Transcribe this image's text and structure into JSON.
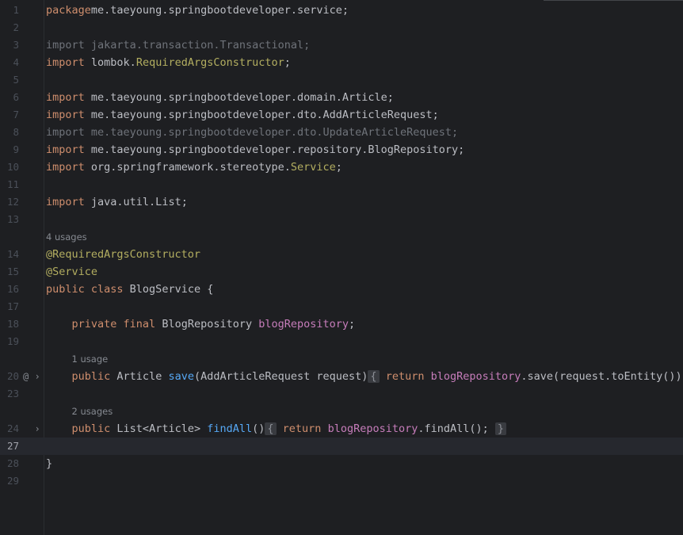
{
  "editor": {
    "lines": [
      {
        "ln": "1",
        "tokens": [
          [
            "kw",
            "package"
          ],
          [
            "",
            "me.taeyoung.springbootdeveloper.service;"
          ]
        ]
      },
      {
        "ln": "2",
        "tokens": []
      },
      {
        "ln": "3",
        "tokens": [
          [
            "dim",
            "import jakarta.transaction.Transactional;"
          ]
        ]
      },
      {
        "ln": "4",
        "tokens": [
          [
            "kw",
            "import"
          ],
          [
            "",
            " lombok."
          ],
          [
            "ann",
            "RequiredArgsConstructor"
          ],
          [
            "",
            ";"
          ]
        ]
      },
      {
        "ln": "5",
        "tokens": []
      },
      {
        "ln": "6",
        "tokens": [
          [
            "kw",
            "import"
          ],
          [
            "",
            " me.taeyoung.springbootdeveloper.domain.Article;"
          ]
        ]
      },
      {
        "ln": "7",
        "tokens": [
          [
            "kw",
            "import"
          ],
          [
            "",
            " me.taeyoung.springbootdeveloper.dto.AddArticleRequest;"
          ]
        ]
      },
      {
        "ln": "8",
        "tokens": [
          [
            "dim",
            "import me.taeyoung.springbootdeveloper.dto.UpdateArticleRequest;"
          ]
        ]
      },
      {
        "ln": "9",
        "tokens": [
          [
            "kw",
            "import"
          ],
          [
            "",
            " me.taeyoung.springbootdeveloper.repository.BlogRepository;"
          ]
        ]
      },
      {
        "ln": "10",
        "tokens": [
          [
            "kw",
            "import"
          ],
          [
            "",
            " org.springframework.stereotype."
          ],
          [
            "ann",
            "Service"
          ],
          [
            "",
            ";"
          ]
        ]
      },
      {
        "ln": "11",
        "tokens": []
      },
      {
        "ln": "12",
        "tokens": [
          [
            "kw",
            "import"
          ],
          [
            "",
            " java.util.List;"
          ]
        ]
      },
      {
        "ln": "13",
        "tokens": []
      },
      {
        "ln": "",
        "tokens": [
          [
            "hint",
            "4 usages"
          ]
        ]
      },
      {
        "ln": "14",
        "tokens": [
          [
            "ann",
            "@RequiredArgsConstructor"
          ]
        ]
      },
      {
        "ln": "15",
        "tokens": [
          [
            "ann",
            "@Service"
          ]
        ]
      },
      {
        "ln": "16",
        "tokens": [
          [
            "kw",
            "public class"
          ],
          [
            "",
            " BlogService {"
          ]
        ]
      },
      {
        "ln": "17",
        "tokens": []
      },
      {
        "ln": "18",
        "tokens": [
          [
            "",
            "    "
          ],
          [
            "kw",
            "private final"
          ],
          [
            "",
            " BlogRepository "
          ],
          [
            "fld",
            "blogRepository"
          ],
          [
            "",
            ";"
          ]
        ]
      },
      {
        "ln": "19",
        "tokens": []
      },
      {
        "ln": "",
        "tokens": [
          [
            "",
            "    "
          ],
          [
            "hint",
            "1 usage"
          ]
        ]
      },
      {
        "ln": "20",
        "icons": "@ ›",
        "tokens": [
          [
            "",
            "    "
          ],
          [
            "kw",
            "public"
          ],
          [
            "",
            " Article "
          ],
          [
            "fn",
            "save"
          ],
          [
            "",
            "(AddArticleRequest request)"
          ],
          [
            "fold",
            "{"
          ],
          [
            "kw",
            " return"
          ],
          [
            "",
            " "
          ],
          [
            "fld",
            "blogRepository"
          ],
          [
            "",
            ".save(request.toEntity());"
          ]
        ]
      },
      {
        "ln": "23",
        "tokens": []
      },
      {
        "ln": "",
        "tokens": [
          [
            "",
            "    "
          ],
          [
            "hint",
            "2 usages"
          ]
        ]
      },
      {
        "ln": "24",
        "icons": "  ›",
        "tokens": [
          [
            "",
            "    "
          ],
          [
            "kw",
            "public"
          ],
          [
            "",
            " List<Article> "
          ],
          [
            "fn",
            "findAll"
          ],
          [
            "",
            "()"
          ],
          [
            "fold",
            "{"
          ],
          [
            "kw",
            " return"
          ],
          [
            "",
            " "
          ],
          [
            "fld",
            "blogRepository"
          ],
          [
            "",
            ".findAll(); "
          ],
          [
            "fold",
            "}"
          ]
        ]
      },
      {
        "ln": "27",
        "current": true,
        "tokens": []
      },
      {
        "ln": "28",
        "tokens": [
          [
            "",
            "}"
          ]
        ]
      },
      {
        "ln": "29",
        "tokens": []
      }
    ]
  }
}
